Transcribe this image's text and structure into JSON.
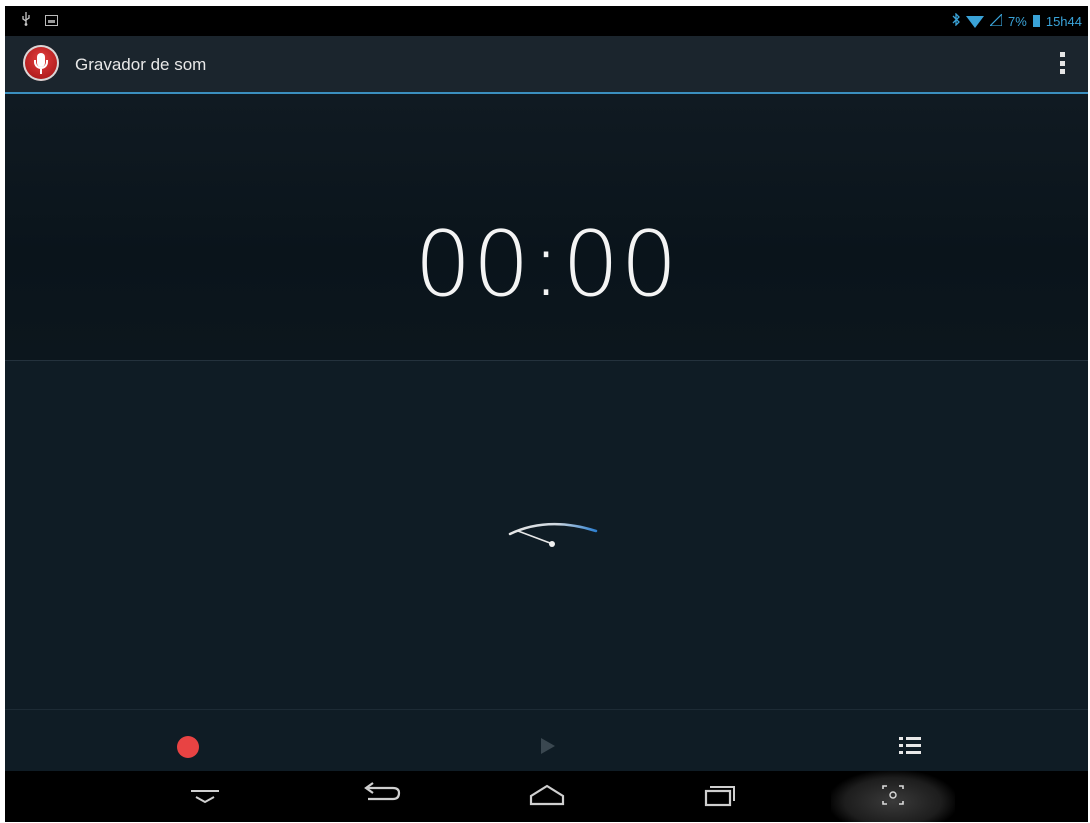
{
  "status_bar": {
    "battery_percent": "7%",
    "time": "15h44",
    "icons": [
      "usb-icon",
      "image-notification-icon",
      "bluetooth-icon",
      "wifi-icon",
      "signal-icon",
      "battery-icon"
    ]
  },
  "action_bar": {
    "title": "Gravador de som",
    "app_icon": "microphone-icon",
    "menu_icon": "overflow-menu-icon"
  },
  "timer": {
    "value": "00:00"
  },
  "meter": {
    "icon": "vu-meter-icon",
    "level": 0
  },
  "controls": {
    "record_icon": "record-icon",
    "play_icon": "play-icon",
    "list_icon": "list-icon",
    "record_color": "#e84343",
    "play_enabled": false
  },
  "nav_bar": {
    "buttons": [
      "hide-keyboard-icon",
      "back-icon",
      "home-icon",
      "recent-apps-icon",
      "screenshot-icon"
    ]
  },
  "colors": {
    "accent": "#3b8fbf",
    "background": "#0f1c25",
    "record": "#e84343"
  }
}
